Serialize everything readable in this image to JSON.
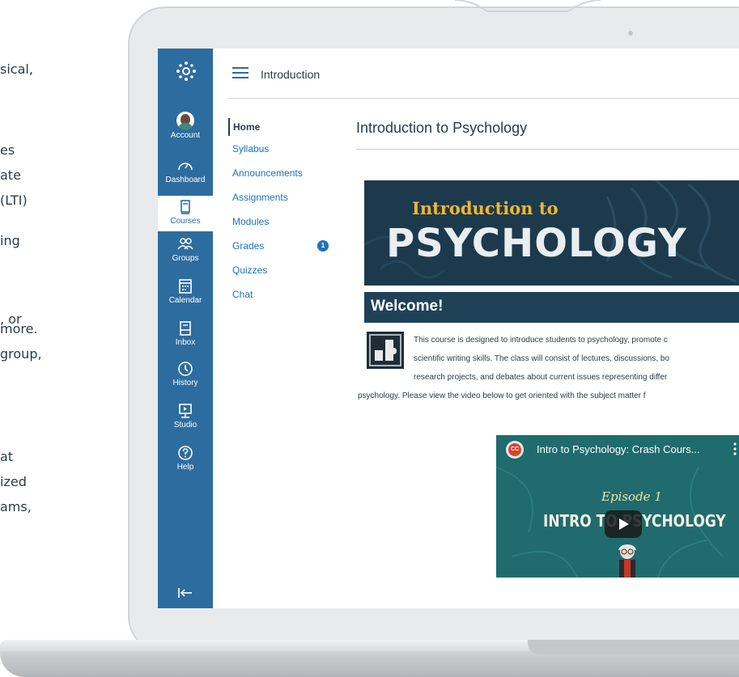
{
  "background_text_lines": [
    "sical,",
    "es",
    "ate",
    "(LTI)",
    "ing",
    ", or",
    " more.",
    "group,",
    "at",
    "ized",
    "ams,"
  ],
  "global_nav": {
    "items": [
      {
        "label": "Account",
        "icon": "avatar"
      },
      {
        "label": "Dashboard",
        "icon": "dashboard-icon"
      },
      {
        "label": "Courses",
        "icon": "courses-icon"
      },
      {
        "label": "Groups",
        "icon": "groups-icon"
      },
      {
        "label": "Calendar",
        "icon": "calendar-icon"
      },
      {
        "label": "Inbox",
        "icon": "inbox-icon"
      },
      {
        "label": "History",
        "icon": "history-icon"
      },
      {
        "label": "Studio",
        "icon": "studio-icon"
      },
      {
        "label": "Help",
        "icon": "help-icon"
      }
    ],
    "active": "Courses",
    "color": "#2d6c9e"
  },
  "breadcrumb": "Introduction",
  "course_nav": {
    "items": [
      {
        "label": "Home"
      },
      {
        "label": "Syllabus"
      },
      {
        "label": "Announcements"
      },
      {
        "label": "Assignments"
      },
      {
        "label": "Modules"
      },
      {
        "label": "Grades",
        "badge": "1"
      },
      {
        "label": "Quizzes"
      },
      {
        "label": "Chat"
      }
    ],
    "active": "Home",
    "link_color": "#1d73b8"
  },
  "page": {
    "title": "Introduction to Psychology",
    "banner_line1": "Introduction to",
    "banner_line2": "PSYCHOLOGY",
    "welcome": "Welcome!",
    "paragraph_lines": [
      "This course is designed to introduce students to psychology, promote c",
      "scientific writing skills. The class will consist of lectures, discussions, bo",
      "research projects, and debates about current issues representing differ",
      "psychology. Please view the video below to get oriented with the subject matter f"
    ]
  },
  "video": {
    "title": "Intro to Psychology: Crash Cours...",
    "episode": "Episode 1",
    "headline": "INTRO TO PSYCHOLOGY",
    "channel_badge": "CC"
  }
}
